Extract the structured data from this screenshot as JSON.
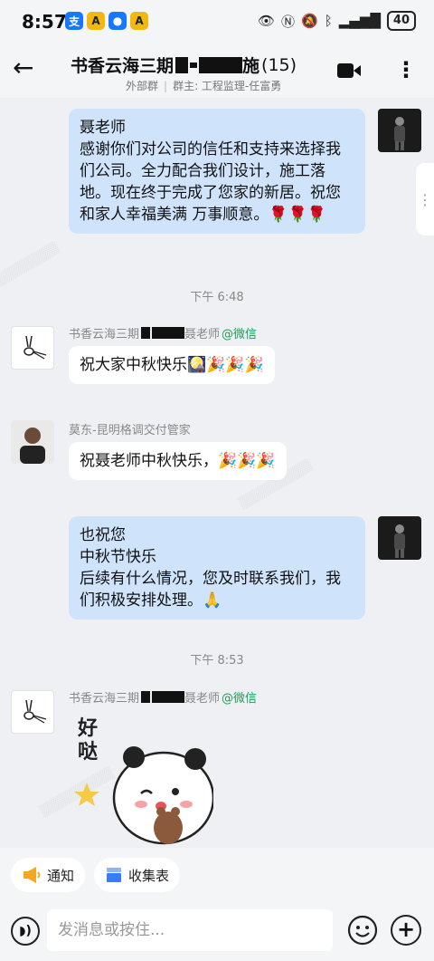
{
  "status_bar": {
    "time": "8:57",
    "app_icons": [
      {
        "name": "alipay-icon",
        "glyph": "支",
        "color": "#1677ff"
      },
      {
        "name": "app-notify-icon",
        "glyph": "A",
        "color": "#f0b90b"
      },
      {
        "name": "chat-app-icon",
        "glyph": "●",
        "color": "#1677ff"
      },
      {
        "name": "app-notify-icon-2",
        "glyph": "A",
        "color": "#f0b90b"
      }
    ],
    "battery": "40"
  },
  "header": {
    "title_prefix": "书香云海三期",
    "title_suffix": "施",
    "member_count": "(15)",
    "tag": "外部群",
    "owner_label": "群主: 工程监理-任富勇"
  },
  "messages": [
    {
      "side": "right",
      "text": "聂老师\n感谢你们对公司的信任和支持来选择我们公司。全力配合我们设计，施工落地。现在终于完成了您家的新居。祝您和家人幸福美满   万事顺意。🌹🌹🌹"
    },
    {
      "timestamp": "下午 6:48"
    },
    {
      "side": "left",
      "sender_prefix": "书香云海三期",
      "sender_suffix": "聂老师",
      "sender_source": "@微信",
      "text": "祝大家中秋快乐🎑🎉🎉🎉"
    },
    {
      "side": "left",
      "sender": "莫东-昆明格调交付管家",
      "text": "祝聂老师中秋快乐，🎉🎉🎉"
    },
    {
      "side": "right",
      "text": "也祝您\n中秋节快乐\n后续有什么情况，您及时联系我们，我们积极安排处理。🙏"
    },
    {
      "timestamp": "下午 8:53"
    },
    {
      "side": "left",
      "sender_prefix": "书香云海三期",
      "sender_suffix": "聂老师",
      "sender_source": "@微信",
      "sticker_text": "好哒"
    }
  ],
  "quick_actions": [
    {
      "label": "通知",
      "icon": "megaphone-icon",
      "color": "#f5a623"
    },
    {
      "label": "收集表",
      "icon": "form-icon",
      "color": "#3b7cf5"
    }
  ],
  "input": {
    "placeholder": "发消息或按住..."
  },
  "colors": {
    "accent": "#18a058",
    "bubble_right": "#cfe3fb",
    "background": "#eef0f3"
  }
}
